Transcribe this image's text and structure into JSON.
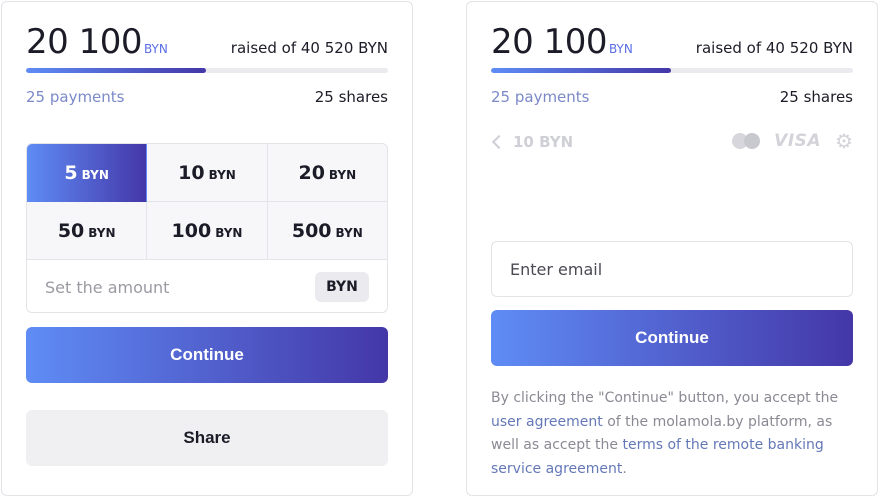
{
  "left_card": {
    "amount": "20 100",
    "amount_currency": "BYN",
    "raised_text": "raised of 40 520 BYN",
    "progress": 0.496,
    "payments": "25 payments",
    "shares": "25 shares",
    "amounts": [
      {
        "value": "5",
        "currency": "BYN",
        "selected": true
      },
      {
        "value": "10",
        "currency": "BYN",
        "selected": false
      },
      {
        "value": "20",
        "currency": "BYN",
        "selected": false
      },
      {
        "value": "50",
        "currency": "BYN",
        "selected": false
      },
      {
        "value": "100",
        "currency": "BYN",
        "selected": false
      },
      {
        "value": "500",
        "currency": "BYN",
        "selected": false
      }
    ],
    "custom_placeholder": "Set the amount",
    "custom_currency": "BYN",
    "continue_label": "Continue",
    "share_label": "Share"
  },
  "right_card": {
    "amount": "20 100",
    "amount_currency": "BYN",
    "raised_text": "raised of 40 520 BYN",
    "progress": 0.496,
    "payments": "25 payments",
    "shares": "25 shares",
    "back_amount": "10 BYN",
    "visa_label": "VISA",
    "email_placeholder": "Enter email",
    "continue_label": "Continue",
    "legal": {
      "part1": "By clicking the \"Continue\" button, you accept the ",
      "link1": "user agreement",
      "part2": " of the molamola.by platform, as well as accept the ",
      "link2": "terms of the remote banking service agreement",
      "part3": "."
    }
  },
  "colors": {
    "accent_start": "#5f8cf5",
    "accent_end": "#4437a8",
    "link": "#6478b8",
    "muted": "#7b89c8"
  }
}
